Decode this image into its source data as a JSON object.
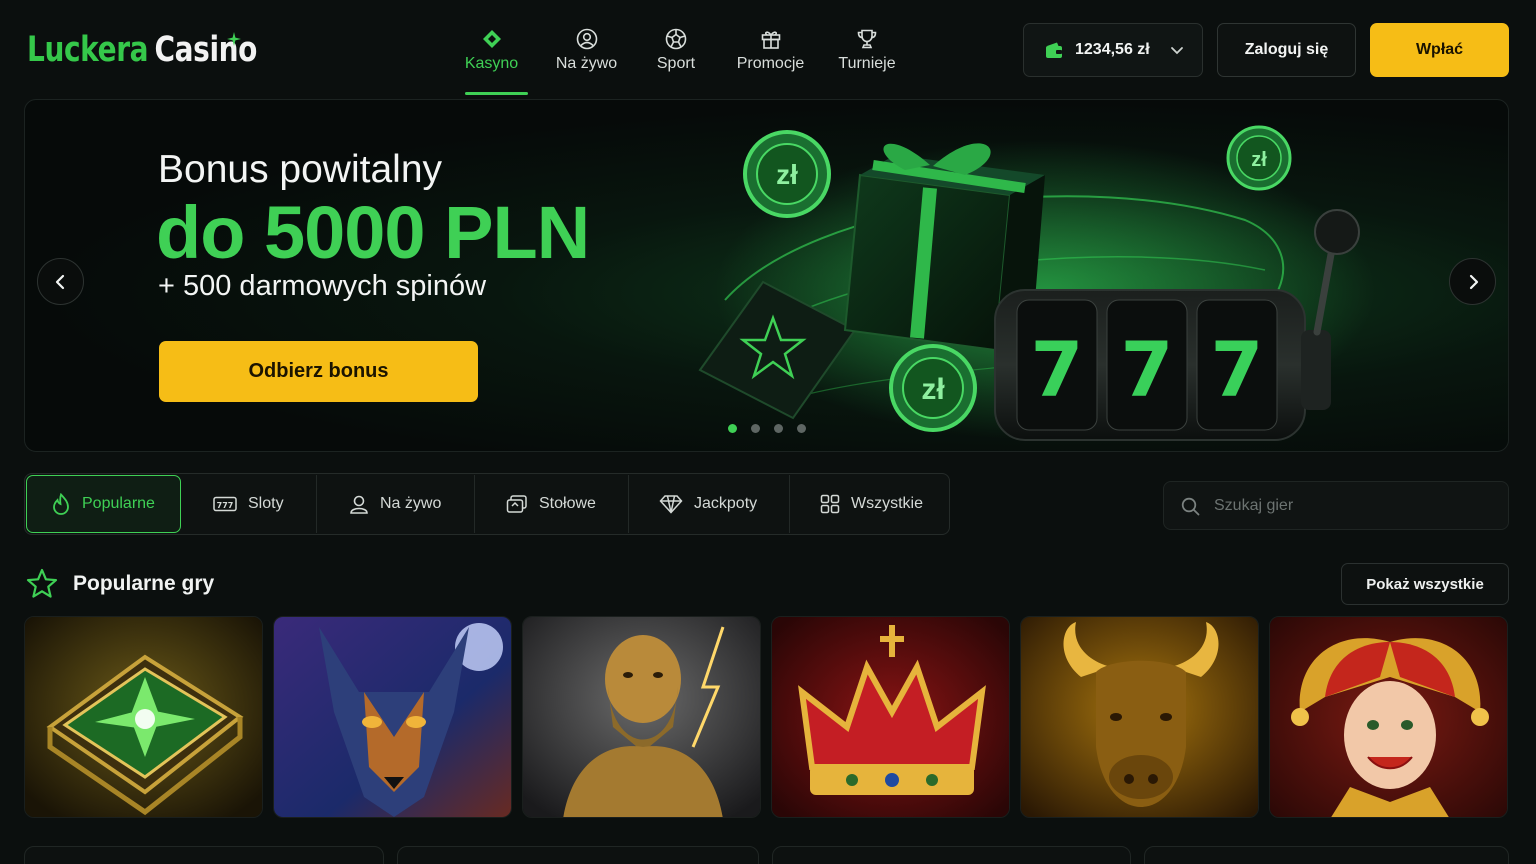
{
  "header": {
    "logo": {
      "part1": "Luckera",
      "part2": "Casino"
    },
    "nav": [
      {
        "label": "Kasyno",
        "icon": "casino-chip-icon",
        "active": true
      },
      {
        "label": "Na żywo",
        "icon": "live-dealer-icon",
        "active": false
      },
      {
        "label": "Sport",
        "icon": "football-icon",
        "active": false
      },
      {
        "label": "Promocje",
        "icon": "gift-icon",
        "active": false
      },
      {
        "label": "Turnieje",
        "icon": "trophy-icon",
        "active": false
      }
    ],
    "wallet": {
      "balance": "1234,56 zł",
      "icon": "wallet-icon"
    },
    "login_label": "Zaloguj się",
    "deposit_label": "Wpłać"
  },
  "hero": {
    "line1": "Bonus powitalny",
    "line2": "do 5000 PLN",
    "line3": "+ 500 darmowych spinów",
    "cta": "Odbierz bonus",
    "slide_count": 4,
    "active_slide": 1,
    "coin_label": "zł",
    "reel_symbols": [
      "7",
      "7",
      "7"
    ]
  },
  "categories": [
    {
      "label": "Popularne",
      "icon": "flame-icon",
      "active": true
    },
    {
      "label": "Sloty",
      "icon": "slot-777-icon",
      "active": false
    },
    {
      "label": "Na żywo",
      "icon": "live-dealer-icon",
      "active": false
    },
    {
      "label": "Stołowe",
      "icon": "cards-icon",
      "active": false
    },
    {
      "label": "Jackpoty",
      "icon": "diamond-icon",
      "active": false
    },
    {
      "label": "Wszystkie",
      "icon": "grid-icon",
      "active": false
    }
  ],
  "search": {
    "placeholder": "Szukaj gier"
  },
  "popular": {
    "title": "Popularne gry",
    "show_all": "Pokaż wszystkie",
    "games": [
      {
        "theme": "emerald-book"
      },
      {
        "theme": "wolf"
      },
      {
        "theme": "zeus"
      },
      {
        "theme": "royal-crown"
      },
      {
        "theme": "golden-bull"
      },
      {
        "theme": "jester"
      }
    ]
  },
  "colors": {
    "accent_green": "#3fd055",
    "accent_yellow": "#f6bd16",
    "background": "#0b0f0e"
  }
}
